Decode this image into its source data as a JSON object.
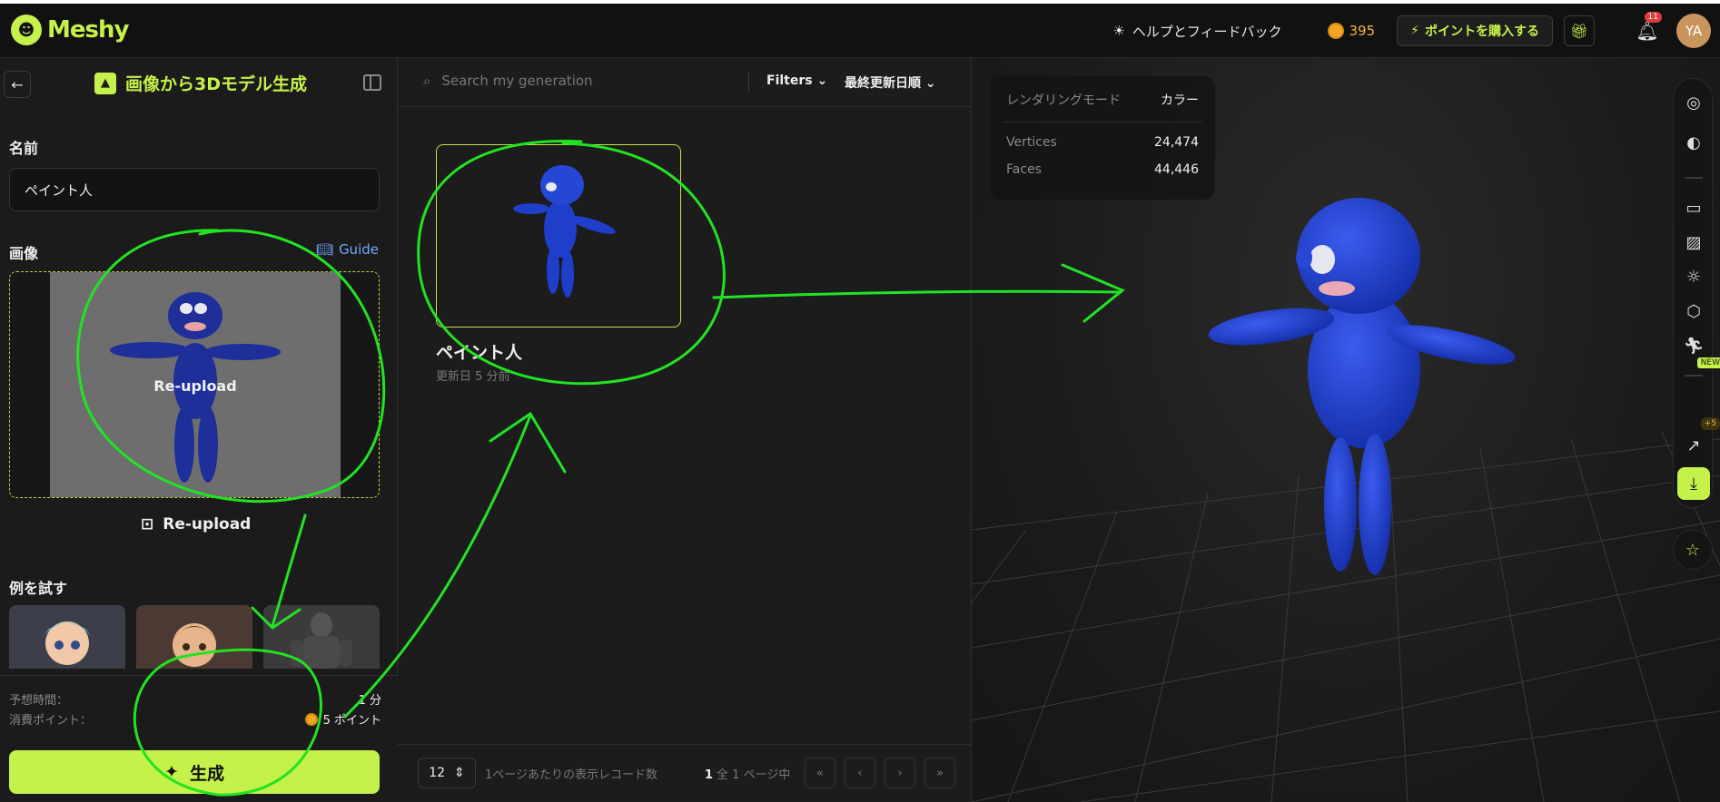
{
  "app": {
    "logo_text": "Meshy",
    "help_label": "ヘルプとフィードバック",
    "points": "395",
    "buy_label": "ポイントを購入する",
    "notifications": "11",
    "avatar_initials": "YA"
  },
  "left_panel": {
    "title": "画像から3Dモデル生成",
    "name_label": "名前",
    "name_value": "ペイント人",
    "image_label": "画像",
    "guide_label": "Guide",
    "reupload_overlay": "Re-upload",
    "reupload_button": "Re-upload",
    "examples_label": "例を試す",
    "est_time_label": "予想時間：",
    "est_time_value": "1 分",
    "cost_label": "消費ポイント：",
    "cost_value": "5 ポイント",
    "generate_label": "生成"
  },
  "gallery": {
    "search_placeholder": "Search my generation",
    "filters_label": "Filters",
    "sort_label": "最終更新日順",
    "card_title": "ペイント人",
    "card_subtitle": "更新日 5 分前",
    "page_size": "12",
    "page_size_label": "1ページあたりの表示レコード数",
    "page_current": "1",
    "page_total_text": "全 1 ページ中"
  },
  "viewer": {
    "render_mode_label": "レンダリングモード",
    "render_mode_value": "カラー",
    "vertices_label": "Vertices",
    "vertices_value": "24,474",
    "faces_label": "Faces",
    "faces_value": "44,446",
    "new_badge": "NEW",
    "points_badge": "+5"
  },
  "colors": {
    "accent": "#c5f24a",
    "model_blue": "#1f3ec9",
    "annotation_green": "#22e322",
    "coin": "#f2a623"
  }
}
